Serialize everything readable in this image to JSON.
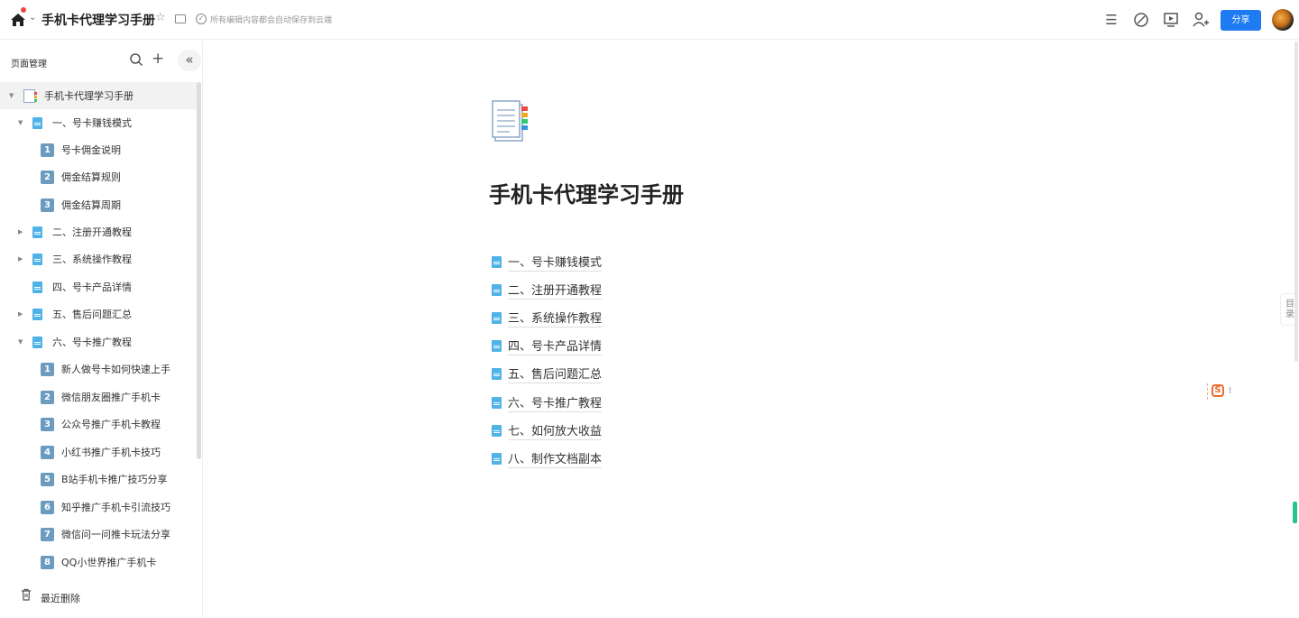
{
  "header": {
    "doc_title": "手机卡代理学习手册",
    "save_status": "所有编辑内容都会自动保存到云端",
    "share_label": "分享",
    "icons": [
      "home-icon",
      "star-icon",
      "folder-icon",
      "cloud-saved-icon",
      "menu-icon",
      "compass-icon",
      "present-icon",
      "add-member-icon"
    ]
  },
  "sidebar": {
    "title": "页面管理",
    "root": {
      "label": "手机卡代理学习手册"
    },
    "items": [
      {
        "label": "一、号卡赚钱模式",
        "type": "section",
        "expanded": true
      },
      {
        "label": "号卡佣金说明",
        "type": "page",
        "num": "1"
      },
      {
        "label": "佣金结算规则",
        "type": "page",
        "num": "2"
      },
      {
        "label": "佣金结算周期",
        "type": "page",
        "num": "3"
      },
      {
        "label": "二、注册开通教程",
        "type": "section",
        "expanded": false
      },
      {
        "label": "三、系统操作教程",
        "type": "section",
        "expanded": false
      },
      {
        "label": "四、号卡产品详情",
        "type": "section",
        "expanded": null
      },
      {
        "label": "五、售后问题汇总",
        "type": "section",
        "expanded": false
      },
      {
        "label": "六、号卡推广教程",
        "type": "section",
        "expanded": true
      },
      {
        "label": "新人做号卡如何快速上手",
        "type": "page",
        "num": "1"
      },
      {
        "label": "微信朋友圈推广手机卡",
        "type": "page",
        "num": "2"
      },
      {
        "label": "公众号推广手机卡教程",
        "type": "page",
        "num": "3"
      },
      {
        "label": "小红书推广手机卡技巧",
        "type": "page",
        "num": "4"
      },
      {
        "label": "B站手机卡推广技巧分享",
        "type": "page",
        "num": "5"
      },
      {
        "label": "知乎推广手机卡引流技巧",
        "type": "page",
        "num": "6"
      },
      {
        "label": "微信问一问推卡玩法分享",
        "type": "page",
        "num": "7"
      },
      {
        "label": "QQ小世界推广手机卡",
        "type": "page",
        "num": "8"
      }
    ],
    "trash_label": "最近删除"
  },
  "main": {
    "title": "手机卡代理学习手册",
    "toc": [
      "一、号卡赚钱模式",
      "二、注册开通教程",
      "三、系统操作教程",
      "四、号卡产品详情",
      "五、售后问题汇总",
      "六、号卡推广教程",
      "七、如何放大收益",
      "八、制作文档副本"
    ],
    "outline_tab": "目录"
  }
}
